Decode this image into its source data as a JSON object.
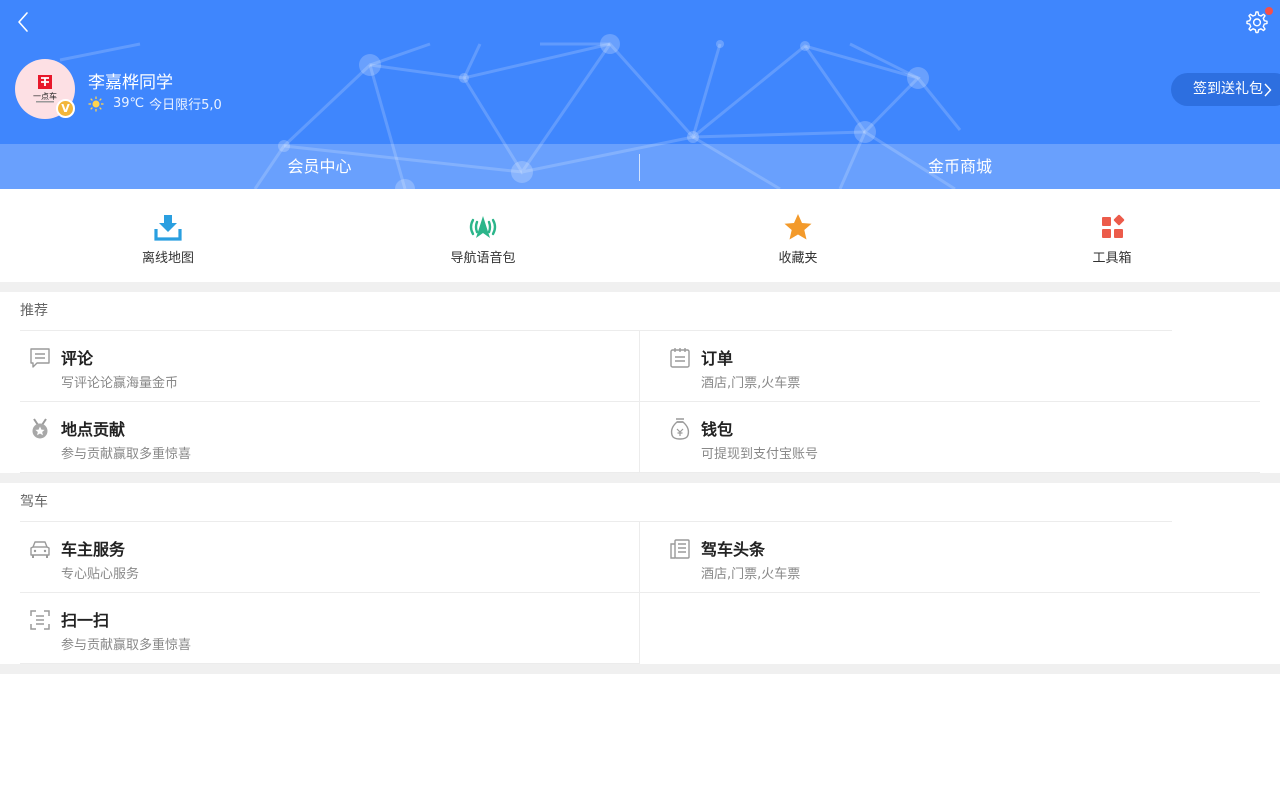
{
  "header": {
    "username": "李嘉桦同学",
    "weather_temp": "39℃",
    "weather_limit": "今日限行5,0",
    "signin_label": "签到送礼包",
    "avatar_logo_text": "一点车",
    "vip_badge": "V",
    "tabs": [
      {
        "label": "会员中心"
      },
      {
        "label": "金币商城"
      }
    ],
    "colors": {
      "primary": "#3f86fd",
      "badge": "#f2b63b",
      "notify": "#f5504b"
    }
  },
  "quick_tools": [
    {
      "label": "离线地图",
      "icon": "download-icon",
      "color": "#2a9fe0"
    },
    {
      "label": "导航语音包",
      "icon": "broadcast-icon",
      "color": "#2bb58a"
    },
    {
      "label": "收藏夹",
      "icon": "star-icon",
      "color": "#f39a2b"
    },
    {
      "label": "工具箱",
      "icon": "toolbox-icon",
      "color": "#ec5b4a"
    }
  ],
  "sections": [
    {
      "title": "推荐",
      "items": [
        {
          "title": "评论",
          "subtitle": "写评论论赢海量金币",
          "icon": "comment-icon"
        },
        {
          "title": "订单",
          "subtitle": "酒店,门票,火车票",
          "icon": "order-icon"
        },
        {
          "title": "地点贡献",
          "subtitle": "参与贡献赢取多重惊喜",
          "icon": "medal-icon"
        },
        {
          "title": "钱包",
          "subtitle": "可提现到支付宝账号",
          "icon": "wallet-icon"
        }
      ]
    },
    {
      "title": "驾车",
      "items": [
        {
          "title": "车主服务",
          "subtitle": "专心贴心服务",
          "icon": "car-icon"
        },
        {
          "title": "驾车头条",
          "subtitle": "酒店,门票,火车票",
          "icon": "news-icon"
        },
        {
          "title": "扫一扫",
          "subtitle": "参与贡献赢取多重惊喜",
          "icon": "scan-icon"
        }
      ]
    }
  ]
}
